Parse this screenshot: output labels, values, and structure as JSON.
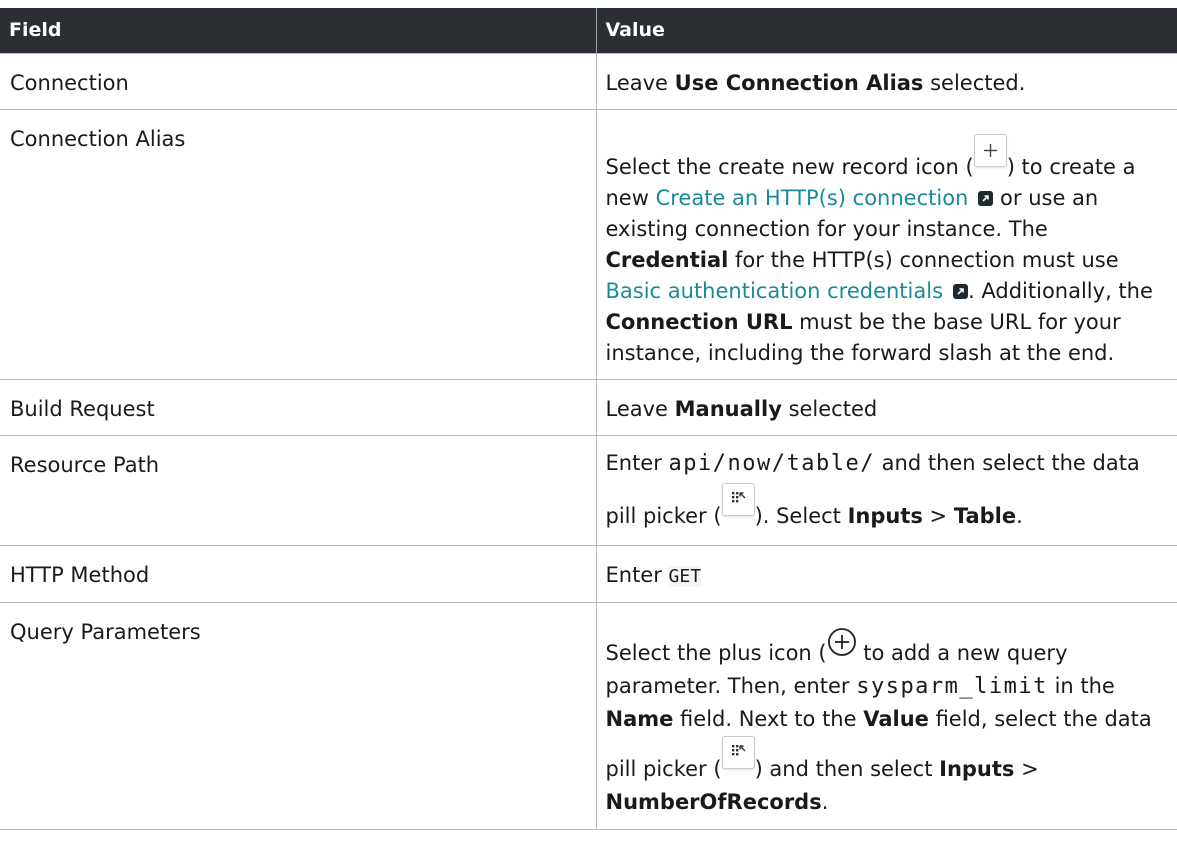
{
  "header": {
    "field": "Field",
    "value": "Value"
  },
  "icons": {
    "plus_box": "plus-box-icon",
    "external_link": "external-link-icon",
    "data_pill_picker": "data-pill-picker-icon",
    "plus_circle": "plus-circle-icon"
  },
  "colors": {
    "header_bg": "#2b2f33",
    "link": "#1a8a9a"
  },
  "rows": {
    "connection": {
      "field": "Connection",
      "v1": "Leave ",
      "v2": "Use Connection Alias",
      "v3": " selected."
    },
    "connection_alias": {
      "field": "Connection Alias",
      "p1": "Select the create new record icon (",
      "p2": ") to create a new ",
      "link1": "Create an HTTP(s) connection",
      "p3": " or use an existing connection for your instance. The ",
      "b1": "Credential",
      "p4": " for the HTTP(s) connection must use ",
      "link2": "Basic authentication credentials",
      "p5": ". Additionally, the ",
      "b2": "Connection URL",
      "p6": " must be the base URL for your instance, including the forward slash at the end."
    },
    "build_request": {
      "field": "Build Request",
      "v1": "Leave ",
      "v2": "Manually",
      "v3": " selected"
    },
    "resource_path": {
      "field": "Resource Path",
      "v1": "Enter ",
      "code": "api/now/table/",
      "v2": " and then select the data pill picker (",
      "v3": "). Select ",
      "b1": "Inputs",
      "v4": " > ",
      "b2": "Table",
      "v5": "."
    },
    "http_method": {
      "field": "HTTP Method",
      "v1": "Enter ",
      "code": "GET"
    },
    "query_parameters": {
      "field": "Query Parameters",
      "v1": "Select the plus icon (",
      "v2": " to add a new query parameter. Then, enter ",
      "code": "sysparm_limit",
      "v3": " in the ",
      "b1": "Name",
      "v4": " field. Next to the ",
      "b2": "Value",
      "v5": " field, select the data pill picker (",
      "v6": ") and then select ",
      "b3": "Inputs",
      "v7": " > ",
      "b4": "NumberOfRecords",
      "v8": "."
    }
  }
}
